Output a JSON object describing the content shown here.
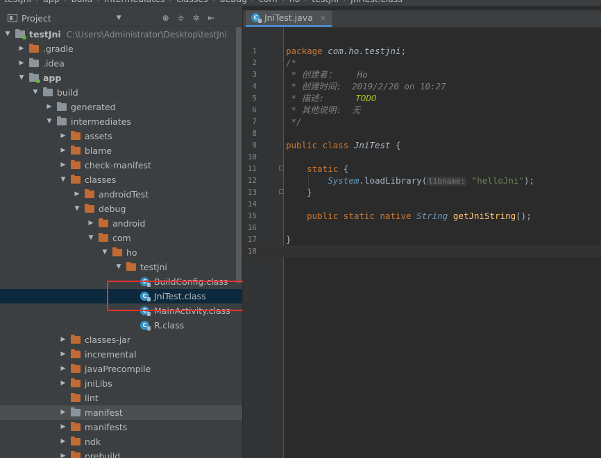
{
  "breadcrumb": [
    "testJni",
    "app",
    "build",
    "intermediates",
    "classes",
    "debug",
    "com",
    "ho",
    "testjni",
    "JniTest.class"
  ],
  "panel": {
    "title": "Project"
  },
  "tree": [
    {
      "label": "testJni",
      "path": "C:\\Users\\Administrator\\Desktop\\testJni",
      "depth": 0,
      "arrow": "down",
      "icon": "folder-module",
      "bold": true
    },
    {
      "label": ".gradle",
      "depth": 1,
      "arrow": "right",
      "icon": "folder-orange"
    },
    {
      "label": ".idea",
      "depth": 1,
      "arrow": "right",
      "icon": "folder-gray"
    },
    {
      "label": "app",
      "depth": 1,
      "arrow": "down",
      "icon": "folder-module",
      "bold": true
    },
    {
      "label": "build",
      "depth": 2,
      "arrow": "down",
      "icon": "folder-gray"
    },
    {
      "label": "generated",
      "depth": 3,
      "arrow": "right",
      "icon": "folder-gray"
    },
    {
      "label": "intermediates",
      "depth": 3,
      "arrow": "down",
      "icon": "folder-gray"
    },
    {
      "label": "assets",
      "depth": 4,
      "arrow": "right",
      "icon": "folder-orange"
    },
    {
      "label": "blame",
      "depth": 4,
      "arrow": "right",
      "icon": "folder-orange"
    },
    {
      "label": "check-manifest",
      "depth": 4,
      "arrow": "right",
      "icon": "folder-orange"
    },
    {
      "label": "classes",
      "depth": 4,
      "arrow": "down",
      "icon": "folder-orange"
    },
    {
      "label": "androidTest",
      "depth": 5,
      "arrow": "right",
      "icon": "folder-orange"
    },
    {
      "label": "debug",
      "depth": 5,
      "arrow": "down",
      "icon": "folder-orange"
    },
    {
      "label": "android",
      "depth": 6,
      "arrow": "right",
      "icon": "folder-orange"
    },
    {
      "label": "com",
      "depth": 6,
      "arrow": "down",
      "icon": "folder-orange"
    },
    {
      "label": "ho",
      "depth": 7,
      "arrow": "down",
      "icon": "folder-orange"
    },
    {
      "label": "testjni",
      "depth": 8,
      "arrow": "down",
      "icon": "folder-orange"
    },
    {
      "label": "BuildConfig.class",
      "depth": 9,
      "arrow": "none",
      "icon": "class"
    },
    {
      "label": "JniTest.class",
      "depth": 9,
      "arrow": "none",
      "icon": "class",
      "selected": true
    },
    {
      "label": "MainActivity.class",
      "depth": 9,
      "arrow": "none",
      "icon": "class"
    },
    {
      "label": "R.class",
      "depth": 9,
      "arrow": "none",
      "icon": "class"
    },
    {
      "label": "classes-jar",
      "depth": 4,
      "arrow": "right",
      "icon": "folder-orange"
    },
    {
      "label": "incremental",
      "depth": 4,
      "arrow": "right",
      "icon": "folder-orange"
    },
    {
      "label": "javaPrecompile",
      "depth": 4,
      "arrow": "right",
      "icon": "folder-orange"
    },
    {
      "label": "jniLibs",
      "depth": 4,
      "arrow": "right",
      "icon": "folder-orange"
    },
    {
      "label": "lint",
      "depth": 4,
      "arrow": "none",
      "icon": "folder-orange"
    },
    {
      "label": "manifest",
      "depth": 4,
      "arrow": "right",
      "icon": "folder-gray",
      "hover": true
    },
    {
      "label": "manifests",
      "depth": 4,
      "arrow": "right",
      "icon": "folder-orange"
    },
    {
      "label": "ndk",
      "depth": 4,
      "arrow": "right",
      "icon": "folder-orange"
    },
    {
      "label": "prebuild",
      "depth": 4,
      "arrow": "right",
      "icon": "folder-orange"
    }
  ],
  "editor": {
    "tab": {
      "label": "JniTest.java",
      "close": "×"
    },
    "lines": [
      [
        [
          "kw",
          "package "
        ],
        [
          "pkg",
          "com.ho.testjni"
        ],
        [
          "plain",
          ";"
        ]
      ],
      [
        [
          "cm",
          "/*"
        ]
      ],
      [
        [
          "cm",
          " * 创建者：    Ho"
        ]
      ],
      [
        [
          "cm",
          " * 创建时间:  2019/2/20 on 10:27"
        ]
      ],
      [
        [
          "cm",
          " * 描述:      "
        ],
        [
          "todo",
          "TODO"
        ]
      ],
      [
        [
          "cm",
          " * 其他说明:  无"
        ]
      ],
      [
        [
          "cm",
          " */"
        ]
      ],
      [],
      [
        [
          "kw",
          "public class "
        ],
        [
          "cls",
          "JniTest"
        ],
        [
          "plain",
          " {"
        ]
      ],
      [],
      [
        [
          "plain",
          "    "
        ],
        [
          "kw",
          "static"
        ],
        [
          "plain",
          " {"
        ]
      ],
      [
        [
          "plain",
          "        "
        ],
        [
          "ty",
          "System"
        ],
        [
          "plain",
          "."
        ],
        [
          "plain",
          "loadLibrary("
        ],
        [
          "hint",
          "libname:"
        ],
        [
          "str",
          " \"helloJni\""
        ],
        [
          "plain",
          ");"
        ]
      ],
      [
        [
          "plain",
          "    }"
        ]
      ],
      [],
      [
        [
          "plain",
          "    "
        ],
        [
          "kw",
          "public static native "
        ],
        [
          "ty",
          "String "
        ],
        [
          "fn",
          "getJniString"
        ],
        [
          "plain",
          "();"
        ]
      ],
      [],
      [
        [
          "plain",
          "}"
        ]
      ],
      []
    ]
  }
}
